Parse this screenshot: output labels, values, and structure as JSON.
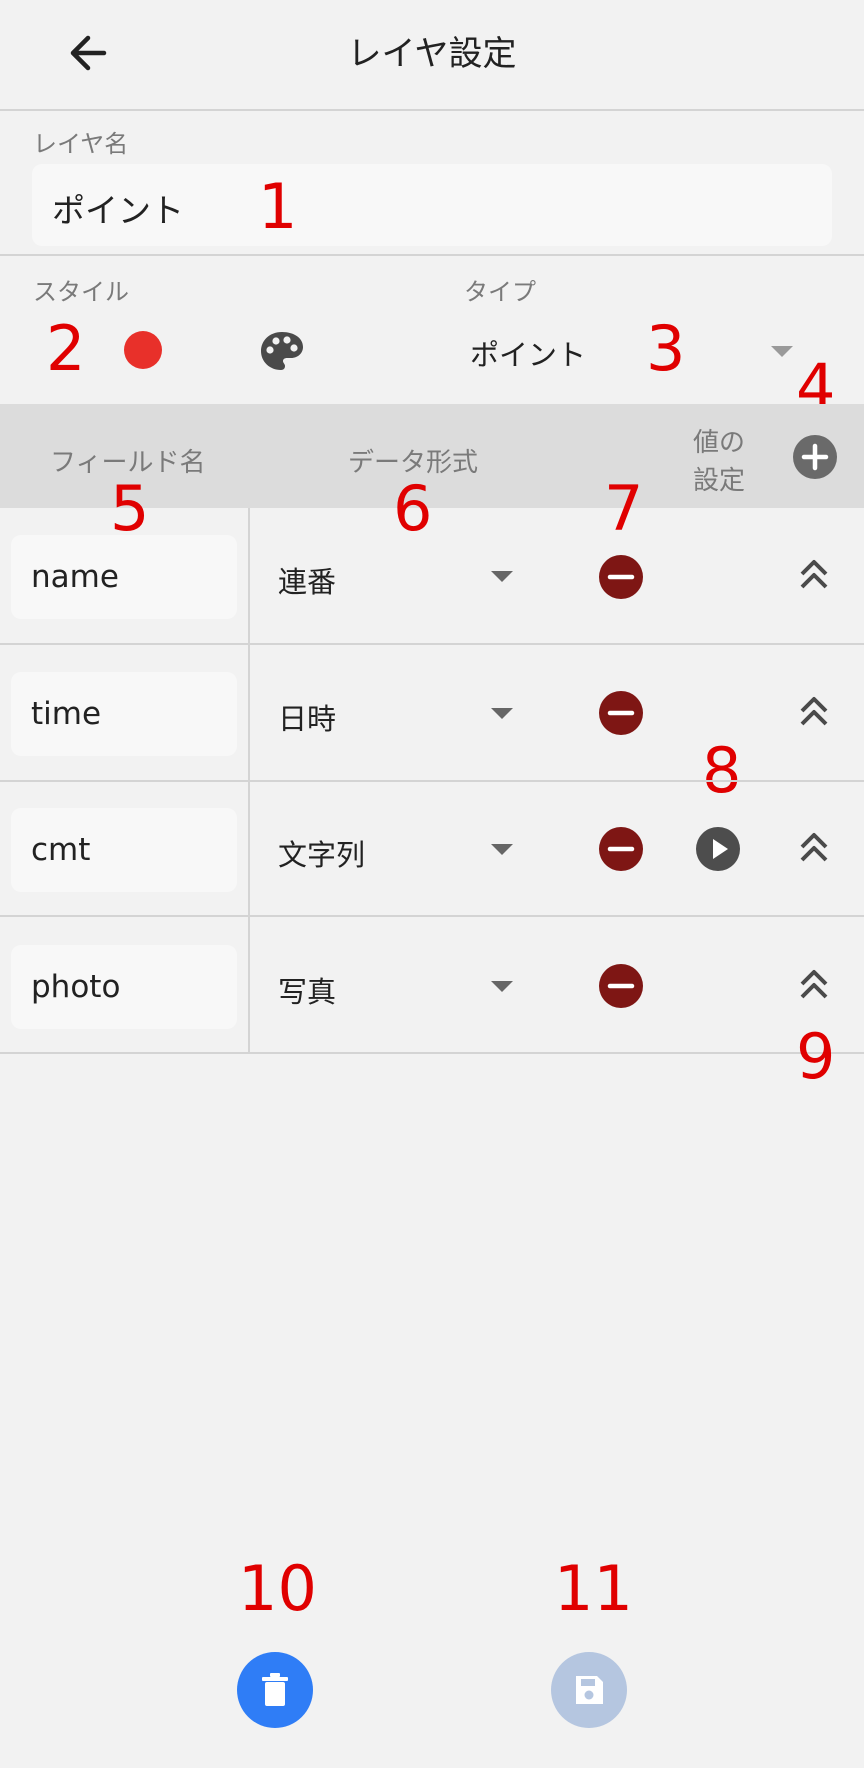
{
  "header": {
    "title": "レイヤ設定"
  },
  "layer_name": {
    "label": "レイヤ名",
    "value": "ポイント"
  },
  "style": {
    "label": "スタイル",
    "color": "#e8302a"
  },
  "type": {
    "label": "タイプ",
    "value": "ポイント"
  },
  "columns": {
    "field_name": "フィールド名",
    "data_format": "データ形式",
    "value_setting_line1": "値の",
    "value_setting_line2": "設定"
  },
  "fields": [
    {
      "name": "name",
      "format": "連番",
      "has_value_setting": false
    },
    {
      "name": "time",
      "format": "日時",
      "has_value_setting": false
    },
    {
      "name": "cmt",
      "format": "文字列",
      "has_value_setting": true
    },
    {
      "name": "photo",
      "format": "写真",
      "has_value_setting": false
    }
  ],
  "annotations": [
    "1",
    "2",
    "3",
    "4",
    "5",
    "6",
    "7",
    "8",
    "9",
    "10",
    "11"
  ],
  "colors": {
    "delete_button": "#2f7df6",
    "save_button_disabled": "#b5c6e0",
    "remove_field": "#7e1614",
    "add_field": "#6a6a6a"
  },
  "icons": [
    "back-arrow-icon",
    "palette-icon",
    "dropdown-caret-icon",
    "add-circle-icon",
    "remove-circle-icon",
    "play-circle-icon",
    "double-chevron-up-icon",
    "trash-icon",
    "save-icon"
  ]
}
